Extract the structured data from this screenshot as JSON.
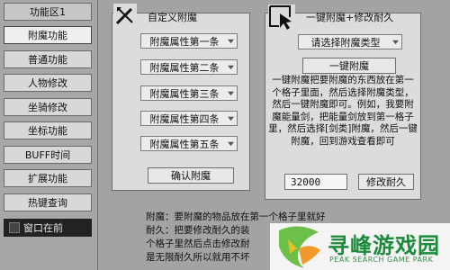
{
  "sidebar": {
    "items": [
      {
        "label": "功能区1"
      },
      {
        "label": "附魔功能"
      },
      {
        "label": "普通功能"
      },
      {
        "label": "人物修改"
      },
      {
        "label": "坐骑修改"
      },
      {
        "label": "坐标功能"
      },
      {
        "label": "BUFF时间"
      },
      {
        "label": "扩展功能"
      },
      {
        "label": "热键查询"
      }
    ],
    "footer_label": "窗口在前"
  },
  "custom_panel": {
    "title": "自定义附魔",
    "icon": "wand-icon",
    "attrs": [
      "附魔属性第一条",
      "附魔属性第二条",
      "附魔属性第三条",
      "附魔属性第四条",
      "附魔属性第五条"
    ],
    "confirm_label": "确认附魔"
  },
  "oneclick_panel": {
    "title": "一键附魔+修改耐久",
    "icon": "cursor-icon",
    "type_select": "请选择附魔类型",
    "enchant_label": "一键附魔",
    "description": "一键附魔把要附魔的东西放在第一个格子里面，然后选择附魔类型，然后一键附魔即可。例如，我要附魔能量剑，把能量剑放到第一格子里，然后选择[剑类]附魔，然后一键附魔，回到游戏查看即可",
    "durability_value": "32000",
    "durability_label": "修改耐久"
  },
  "notes": {
    "line1": "附魔：要附魔的物品放在第一个格子里就好",
    "line2": "耐久：把要修改耐久的装",
    "line3": "个格子里然后点击修改耐",
    "line4": "是无限耐久所以就用不坏"
  },
  "watermark": {
    "name": "寻峰游戏园",
    "sub": "PEAK SEARCH GAME PARK"
  }
}
